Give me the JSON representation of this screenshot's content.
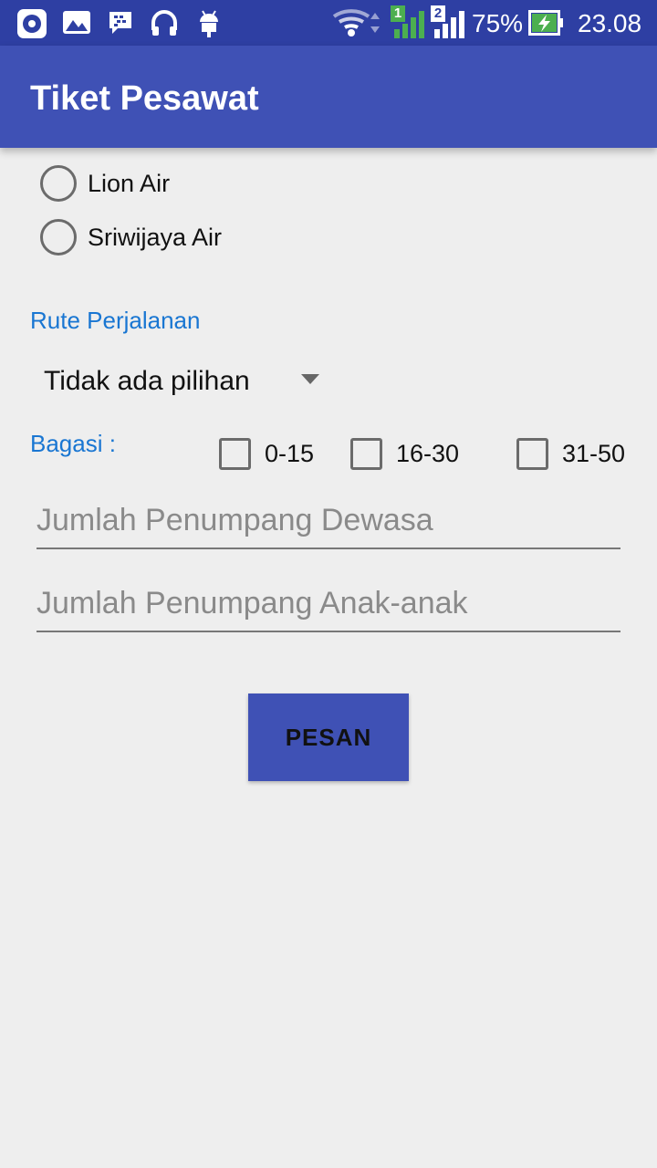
{
  "status_bar": {
    "battery_percent": "75%",
    "time": "23.08",
    "sim1_label": "1",
    "sim2_label": "2",
    "icons_left": [
      "music-player-icon",
      "gallery-icon",
      "bbm-icon",
      "headset-icon",
      "android-icon"
    ],
    "icons_right": [
      "wifi-icon",
      "signal-sim1-icon",
      "signal-sim2-icon",
      "battery-charging-icon"
    ]
  },
  "app_bar": {
    "title": "Tiket Pesawat"
  },
  "airlines": [
    {
      "label": "Lion Air",
      "selected": false
    },
    {
      "label": "Sriwijaya Air",
      "selected": false
    }
  ],
  "route": {
    "label": "Rute Perjalanan",
    "selected_value": "Tidak ada pilihan"
  },
  "baggage": {
    "label": "Bagasi :",
    "options": [
      {
        "label": "0-15",
        "checked": false
      },
      {
        "label": "16-30",
        "checked": false
      },
      {
        "label": "31-50",
        "checked": false
      }
    ]
  },
  "fields": {
    "adult_placeholder": "Jumlah Penumpang Dewasa",
    "adult_value": "",
    "child_placeholder": "Jumlah Penumpang Anak-anak",
    "child_value": ""
  },
  "submit_button": {
    "label": "PESAN"
  },
  "colors": {
    "primary": "#3f51b5",
    "primary_dark": "#2e3fa3",
    "accent_text": "#1976d2",
    "background": "#eeeeee",
    "battery_green": "#4caf50"
  }
}
